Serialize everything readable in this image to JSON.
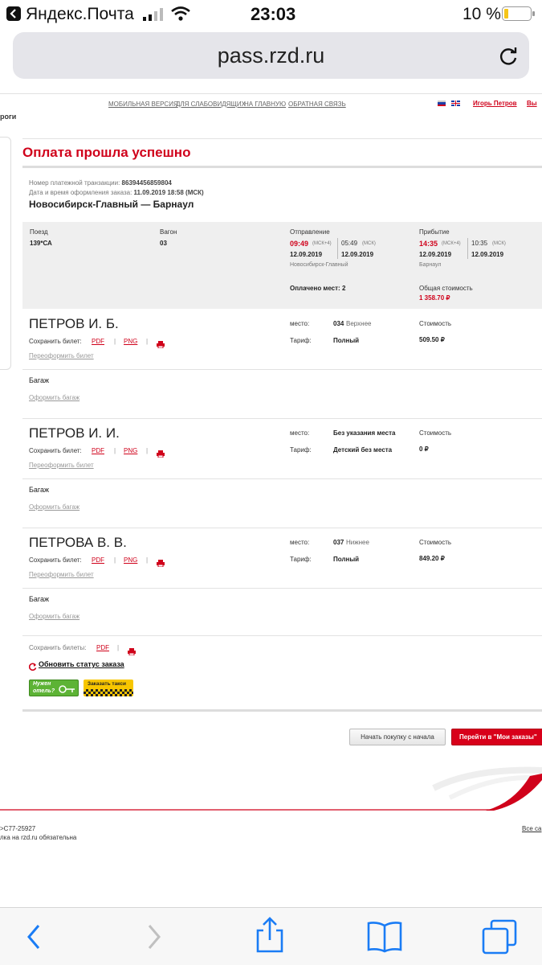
{
  "status_bar": {
    "carrier": "Яндекс.Почта",
    "time": "23:03",
    "battery": "10 %"
  },
  "browser": {
    "url": "pass.rzd.ru"
  },
  "top_nav": {
    "links": [
      "МОБИЛЬНАЯ ВЕРСИЯ",
      "ДЛЯ СЛАБОВИДЯЩИХ",
      "НА ГЛАВНУЮ",
      "ОБРАТНАЯ СВЯЗЬ"
    ],
    "user_name": "Игорь Петров",
    "user_suffix": "Вы",
    "logo_fragment": "роги"
  },
  "page": {
    "title": "Оплата прошла успешно",
    "transaction_label": "Номер платежной транзакции:",
    "transaction_number": "86394456859804",
    "order_date_label": "Дата и время оформления заказа:",
    "order_date": "11.09.2019 18:58 (МСК)",
    "route": "Новосибирск-Главный — Барнаул"
  },
  "trip": {
    "train_label": "Поезд",
    "train": "139*СА",
    "car_label": "Вагон",
    "car": "03",
    "departure_label": "Отправление",
    "departure_time": "09:49",
    "departure_tz": "(МСК+4)",
    "departure_date": "12.09.2019",
    "departure_msk_time": "05:49",
    "departure_msk_tz": "(МСК)",
    "departure_msk_date": "12.09.2019",
    "departure_station": "Новосибирск-Главный",
    "arrival_label": "Прибытие",
    "arrival_time": "14:35",
    "arrival_tz": "(МСК+4)",
    "arrival_date": "12.09.2019",
    "arrival_msk_time": "10:35",
    "arrival_msk_tz": "(МСК)",
    "arrival_msk_date": "12.09.2019",
    "arrival_station": "Барнаул",
    "paid_seats": "Оплачено мест: 2",
    "total_label": "Общая стоимость",
    "total": "1 358.70 ₽"
  },
  "common": {
    "save_ticket": "Сохранить билет:",
    "pdf": "PDF",
    "png": "PNG",
    "sep": "|",
    "reissue": "Переоформить билет",
    "baggage": "Багаж",
    "baggage_link": "Оформить багаж",
    "seat_label": "место:",
    "tariff_label": "Тариф:",
    "cost_label": "Стоимость"
  },
  "passengers": [
    {
      "name": "ПЕТРОВ И. Б.",
      "seat_num": "034",
      "seat_type": "Верхнее",
      "tariff": "Полный",
      "cost": "509.50 ₽"
    },
    {
      "name": "ПЕТРОВ И. И.",
      "seat_num": "Без указания места",
      "seat_type": "",
      "tariff": "Детский без места",
      "cost": "0 ₽"
    },
    {
      "name": "ПЕТРОВА В. В.",
      "seat_num": "037",
      "seat_type": "Нижнее",
      "tariff": "Полный",
      "cost": "849.20 ₽"
    }
  ],
  "footer_actions": {
    "save_tickets": "Сохранить билеты:",
    "pdf": "PDF",
    "refresh_status": "Обновить статус заказа",
    "hotel_banner_1": "Нужен",
    "hotel_banner_2": "отель?",
    "taxi_banner": "Заказать такси",
    "restart_button": "Начать покупку с начала",
    "my_orders_button": "Перейти в \"Мои заказы\""
  },
  "footer": {
    "license": ">С77-25927",
    "notice": "лка на rzd.ru обязательна",
    "all_link": "Все са"
  }
}
